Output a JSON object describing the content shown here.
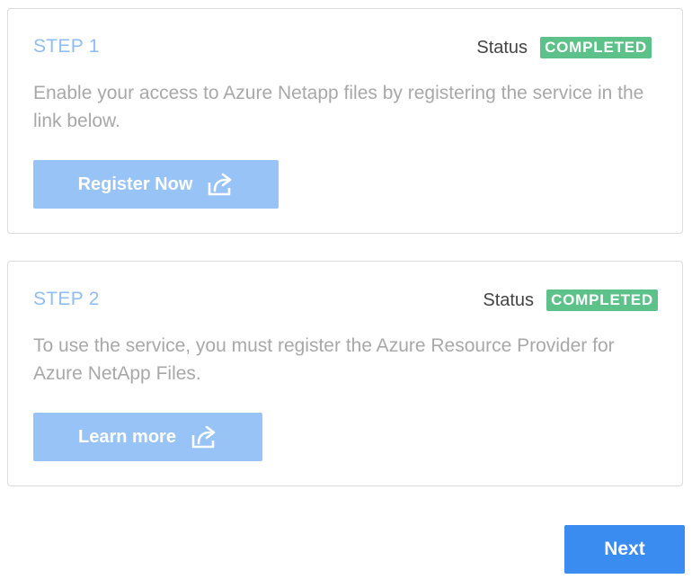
{
  "steps": [
    {
      "title": "STEP 1",
      "status_label": "Status",
      "status_value": "COMPLETED",
      "description": "Enable your access to Azure Netapp files by registering the service in the link below.",
      "button_label": "Register Now",
      "button_icon": "share-external-icon"
    },
    {
      "title": "STEP 2",
      "status_label": "Status",
      "status_value": "COMPLETED",
      "description": "To use the service, you must register the Azure Resource Provider for Azure NetApp Files.",
      "button_label": "Learn more",
      "button_icon": "share-external-icon"
    }
  ],
  "footer": {
    "next_label": "Next"
  },
  "colors": {
    "step_title": "#8fbdf6",
    "status_badge": "#5dc18a",
    "action_button": "#98c3f7",
    "primary_button": "#3b8cf0",
    "description_text": "#a8a8a8"
  }
}
